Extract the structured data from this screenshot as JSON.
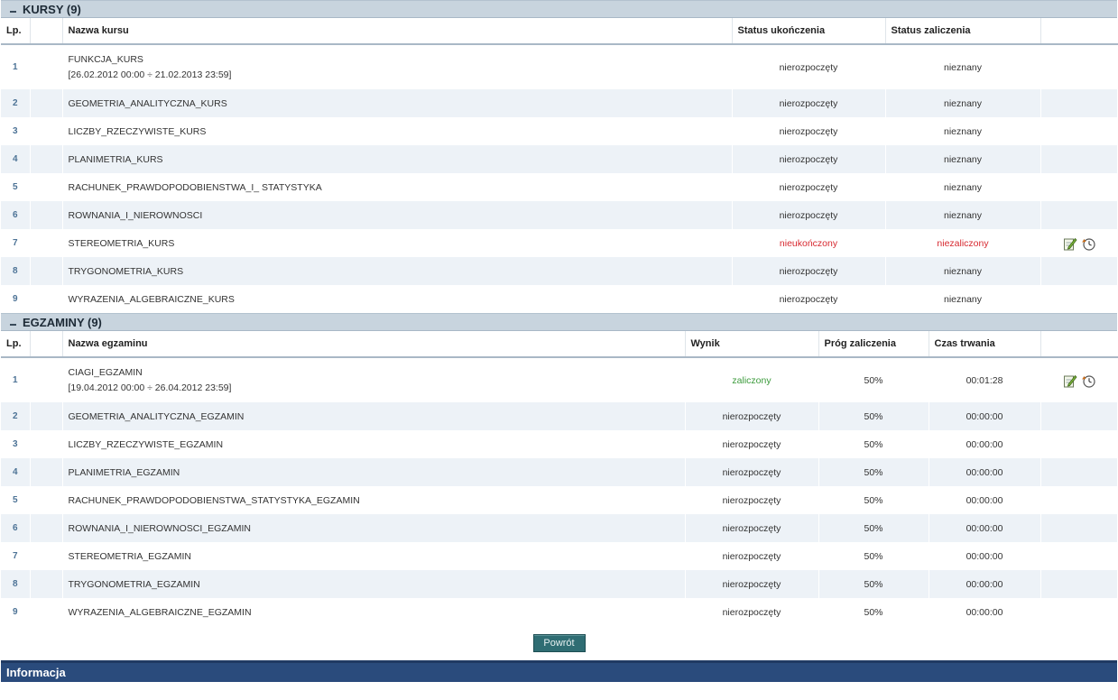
{
  "courses": {
    "title": "KURSY (9)",
    "columns": {
      "lp": "Lp.",
      "name": "Nazwa kursu",
      "completion": "Status ukończenia",
      "pass": "Status zaliczenia"
    },
    "rows": [
      {
        "lp": "1",
        "name": "FUNKCJA_KURS",
        "dates": "[26.02.2012 00:00 ÷ 21.02.2013 23:59]",
        "completion": "nierozpoczęty",
        "pass": "nieznany",
        "highlight": false,
        "icons": false
      },
      {
        "lp": "2",
        "name": "GEOMETRIA_ANALITYCZNA_KURS",
        "dates": "",
        "completion": "nierozpoczęty",
        "pass": "nieznany",
        "highlight": false,
        "icons": false
      },
      {
        "lp": "3",
        "name": "LICZBY_RZECZYWISTE_KURS",
        "dates": "",
        "completion": "nierozpoczęty",
        "pass": "nieznany",
        "highlight": false,
        "icons": false
      },
      {
        "lp": "4",
        "name": "PLANIMETRIA_KURS",
        "dates": "",
        "completion": "nierozpoczęty",
        "pass": "nieznany",
        "highlight": false,
        "icons": false
      },
      {
        "lp": "5",
        "name": "RACHUNEK_PRAWDOPODOBIENSTWA_I_ STATYSTYKA",
        "dates": "",
        "completion": "nierozpoczęty",
        "pass": "nieznany",
        "highlight": false,
        "icons": false
      },
      {
        "lp": "6",
        "name": "ROWNANIA_I_NIEROWNOSCI",
        "dates": "",
        "completion": "nierozpoczęty",
        "pass": "nieznany",
        "highlight": false,
        "icons": false
      },
      {
        "lp": "7",
        "name": "STEREOMETRIA_KURS",
        "dates": "",
        "completion": "nieukończony",
        "pass": "niezaliczony",
        "highlight": true,
        "icons": true
      },
      {
        "lp": "8",
        "name": "TRYGONOMETRIA_KURS",
        "dates": "",
        "completion": "nierozpoczęty",
        "pass": "nieznany",
        "highlight": false,
        "icons": false
      },
      {
        "lp": "9",
        "name": "WYRAZENIA_ALGEBRAICZNE_KURS",
        "dates": "",
        "completion": "nierozpoczęty",
        "pass": "nieznany",
        "highlight": false,
        "icons": false
      }
    ]
  },
  "exams": {
    "title": "EGZAMINY (9)",
    "columns": {
      "lp": "Lp.",
      "name": "Nazwa egzaminu",
      "result": "Wynik",
      "threshold": "Próg zaliczenia",
      "duration": "Czas trwania"
    },
    "rows": [
      {
        "lp": "1",
        "name": "CIAGI_EGZAMIN",
        "dates": "[19.04.2012 00:00 ÷ 26.04.2012 23:59]",
        "result": "zaliczony",
        "threshold": "50%",
        "duration": "00:01:28",
        "passed": true,
        "icons": true
      },
      {
        "lp": "2",
        "name": "GEOMETRIA_ANALITYCZNA_EGZAMIN",
        "dates": "",
        "result": "nierozpoczęty",
        "threshold": "50%",
        "duration": "00:00:00",
        "passed": false,
        "icons": false
      },
      {
        "lp": "3",
        "name": "LICZBY_RZECZYWISTE_EGZAMIN",
        "dates": "",
        "result": "nierozpoczęty",
        "threshold": "50%",
        "duration": "00:00:00",
        "passed": false,
        "icons": false
      },
      {
        "lp": "4",
        "name": "PLANIMETRIA_EGZAMIN",
        "dates": "",
        "result": "nierozpoczęty",
        "threshold": "50%",
        "duration": "00:00:00",
        "passed": false,
        "icons": false
      },
      {
        "lp": "5",
        "name": "RACHUNEK_PRAWDOPODOBIENSTWA_STATYSTYKA_EGZAMIN",
        "dates": "",
        "result": "nierozpoczęty",
        "threshold": "50%",
        "duration": "00:00:00",
        "passed": false,
        "icons": false
      },
      {
        "lp": "6",
        "name": "ROWNANIA_I_NIEROWNOSCI_EGZAMIN",
        "dates": "",
        "result": "nierozpoczęty",
        "threshold": "50%",
        "duration": "00:00:00",
        "passed": false,
        "icons": false
      },
      {
        "lp": "7",
        "name": "STEREOMETRIA_EGZAMIN",
        "dates": "",
        "result": "nierozpoczęty",
        "threshold": "50%",
        "duration": "00:00:00",
        "passed": false,
        "icons": false
      },
      {
        "lp": "8",
        "name": "TRYGONOMETRIA_EGZAMIN",
        "dates": "",
        "result": "nierozpoczęty",
        "threshold": "50%",
        "duration": "00:00:00",
        "passed": false,
        "icons": false
      },
      {
        "lp": "9",
        "name": "WYRAZENIA_ALGEBRAICZNE_EGZAMIN",
        "dates": "",
        "result": "nierozpoczęty",
        "threshold": "50%",
        "duration": "00:00:00",
        "passed": false,
        "icons": false
      }
    ]
  },
  "back_button": "Powrót",
  "info_bar": "Informacja",
  "icons": {
    "edit": "edit-notes-icon",
    "history": "clock-history-icon"
  },
  "colors": {
    "fail": "#d7282f",
    "pass": "#3a9a3a",
    "lp": "#4d7396"
  }
}
